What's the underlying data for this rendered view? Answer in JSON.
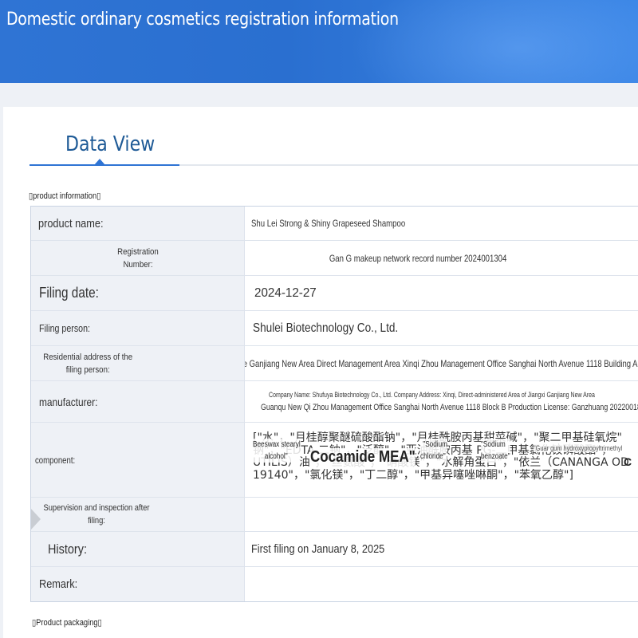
{
  "header": {
    "title": "Domestic ordinary cosmetics registration information"
  },
  "tab": {
    "label": "Data View"
  },
  "sections": {
    "product_info": "▯product information▯",
    "product_packaging": "▯Product packaging▯"
  },
  "fields": {
    "product_name": {
      "label": "product name:",
      "value": "Shu Lei Strong & Shiny Grapeseed Shampoo"
    },
    "registration_number": {
      "label_line1": "Registration",
      "label_line2": "Number:",
      "value": "Gan G makeup network record number 2024001304"
    },
    "filing_date": {
      "label": "Filing date:",
      "value": "2024-12-27"
    },
    "filing_person": {
      "label": "Filing person:",
      "value": "Shulei Biotechnology Co., Ltd."
    },
    "residential_address": {
      "label_line1": "Residential address of the",
      "label_line2": "filing person:",
      "value": "Jiangxi Province Ganjiang New Area Direct Management Area Xinqi Zhou Management Office Sanghai North Avenue 1118 Building A"
    },
    "manufacturer": {
      "label": "manufacturer:",
      "value_line1": "Company Name: Shufuya Biotechnology Co., Ltd. Company Address: Xinqi, Direct-administered Area of Jiangxi Ganjiang New Area",
      "value_line2": "Guanqu New Qi Zhou Management Office Sanghai North Avenue 1118 Block B Production License: Ganzhuang 20220018"
    },
    "component": {
      "label": "component:",
      "zh_line1": "[\"水\"，\"月桂醇聚醚硫酸酯钠\"，\"月桂酰胺丙基甜菜碱\"，\"聚二甲基硅氧烷\"",
      "zh_line2": "钠\"，\"EDTA 二钠\"，\"泛醇\"，\"亚油酰胺丙基 PG-二甲基氯化铵磷酸酯\"，",
      "zh_line3": "UTILIS）油\"，\"丝氨酸\"，\"硝酸镁\"，\"水解角蛋白\"，\"依兰（CANANGA OD",
      "zh_line4": "19140\"，\"氯化镁\"，\"丁二醇\"，\"甲基异噻唑啉酮\"，\"苯氧乙醇\"]",
      "overlay_beeswax_1": "Beeswax stearyl",
      "overlay_beeswax_2": "alcohol\"",
      "overlay_cocamide": "Cocamide MEA\"",
      "overlay_sodium_chloride_1": "\"Sodium",
      "overlay_sodium_chloride_2": "chloride\"",
      "overlay_sodium_benzoate_1": "\"Sodium",
      "overlay_sodium_benzoate_2": "benzoate\"",
      "overlay_guar": "\"Guar gum hydroxypropyltrimethyl",
      "overlay_c": "C"
    },
    "supervision": {
      "label_line1": "Supervision and inspection after",
      "label_line2": "filing:",
      "value": ""
    },
    "history": {
      "label": "History:",
      "value": "First filing on January 8, 2025"
    },
    "remark": {
      "label": "Remark:",
      "value": ""
    }
  }
}
